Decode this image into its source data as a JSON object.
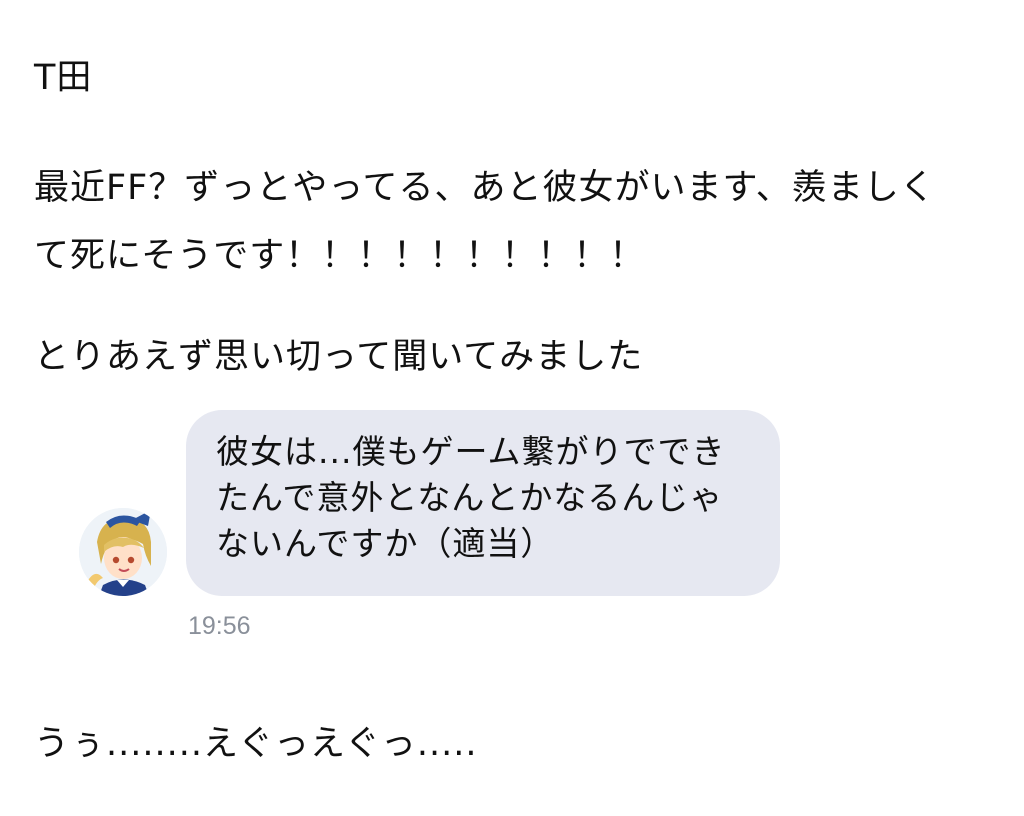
{
  "post": {
    "name_line": "T田",
    "intro_line_1": "最近FF？ずっとやってる、あと彼女がいます、羨ましく",
    "intro_line_2": "て死にそうです！！！！！！！！！！",
    "ask_line": "とりあえず思い切って聞いてみました",
    "reaction_line": "うぅ........えぐっえぐっ....."
  },
  "chat": {
    "avatar_icon": "anime-character-avatar-icon",
    "message_lines": [
      "彼女は...僕もゲーム繋がりででき",
      "たんで意外となんとかなるんじゃ",
      "ないんですか（適当）"
    ],
    "timestamp": "19:56",
    "bubble_color": "#e6e8f1",
    "timestamp_color": "#8a909a"
  }
}
